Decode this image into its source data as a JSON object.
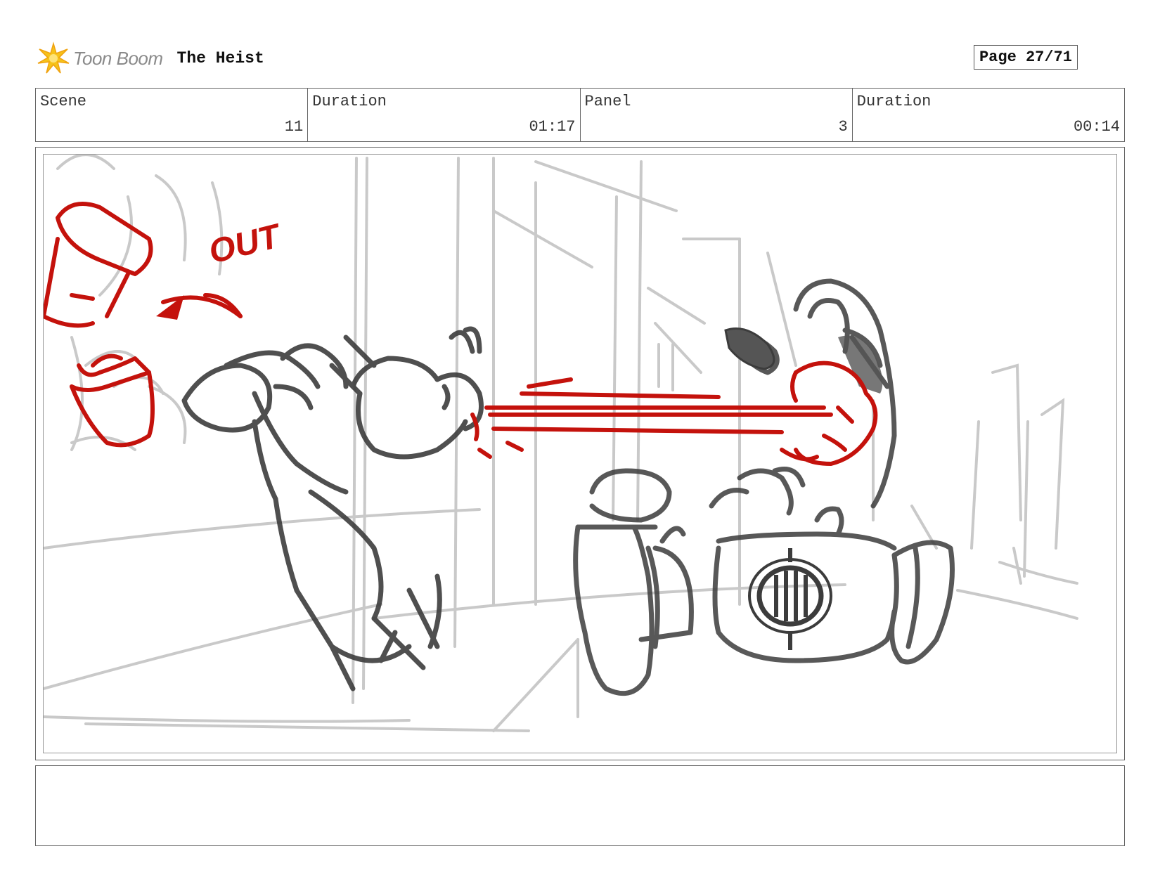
{
  "header": {
    "logo_text": "Toon Boom",
    "project_title": "The Heist",
    "page_label": "Page 27/71"
  },
  "info": {
    "scene_label": "Scene",
    "scene_value": "11",
    "scene_duration_label": "Duration",
    "scene_duration_value": "01:17",
    "panel_label": "Panel",
    "panel_value": "3",
    "panel_duration_label": "Duration",
    "panel_duration_value": "00:14"
  },
  "panel": {
    "annotation_text": "OUT",
    "sketch_colors": {
      "background_lines": "#c9c9c9",
      "characters": "#3c3c3c",
      "action_marks": "#c4120c"
    }
  },
  "notes": {
    "text": ""
  },
  "colors": {
    "logo_star": "#f6c21a",
    "logo_text": "#8a8a8a",
    "border": "#666666"
  }
}
